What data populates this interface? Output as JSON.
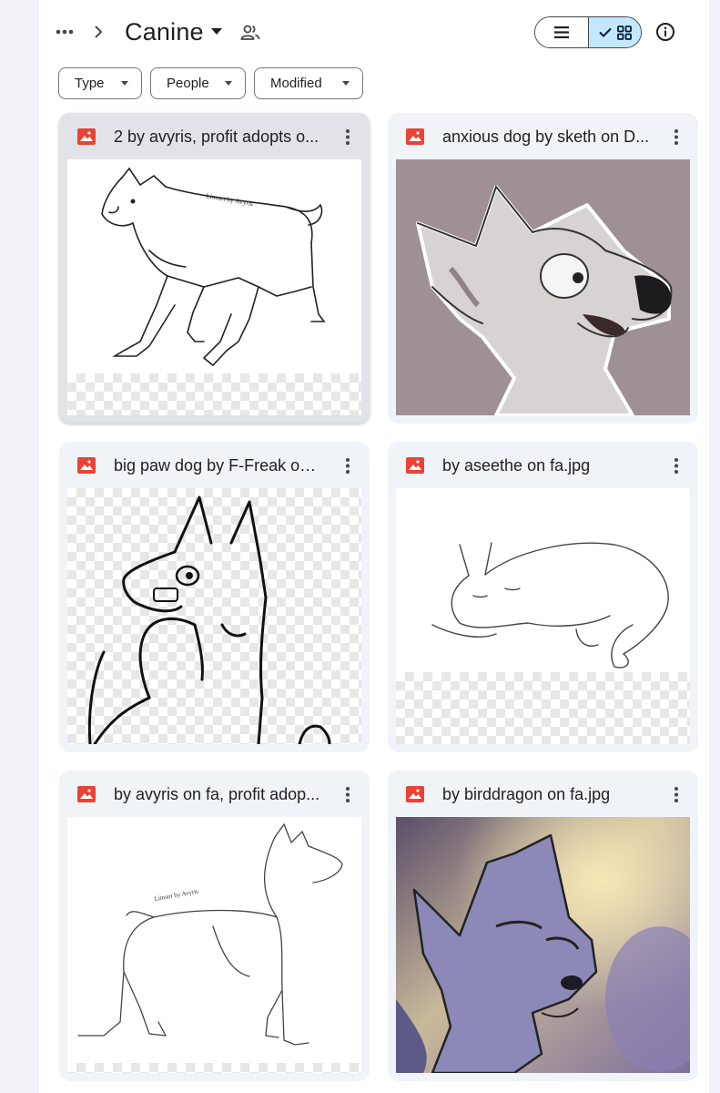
{
  "header": {
    "folder_title": "Canine",
    "view_toggle": {
      "list_icon": "list-icon",
      "grid_icon": "grid-icon",
      "selected": "grid"
    }
  },
  "filters": [
    {
      "label": "Type"
    },
    {
      "label": "People"
    },
    {
      "label": "Modified"
    }
  ],
  "files": [
    {
      "name": "2 by avyris, profit adopts on fa.png",
      "display": "2 by avyris, profit adopts o...",
      "icon": "image-file-icon",
      "selected": true
    },
    {
      "name": "anxious dog by sketh on DA.jpg",
      "display": "anxious dog by sketh on D...",
      "icon": "image-file-icon",
      "selected": false
    },
    {
      "name": "big paw dog by F-Freak on DA.png",
      "display": "big paw dog by F-Freak on ...",
      "icon": "image-file-icon",
      "selected": false
    },
    {
      "name": "by aseethe on fa.jpg",
      "display": "by aseethe on fa.jpg",
      "icon": "image-file-icon",
      "selected": false
    },
    {
      "name": "by avyris on fa, profit adopts.png",
      "display": "by avyris on fa, profit adop...",
      "icon": "image-file-icon",
      "selected": false
    },
    {
      "name": "by birddragon on fa.jpg",
      "display": "by birddragon on fa.jpg",
      "icon": "image-file-icon",
      "selected": false
    }
  ],
  "thumbnails": {
    "watermark_1": "Lineart by Avyris",
    "watermark_5": "Lineart by Avyris"
  },
  "colors": {
    "accent_selected": "#c2e7ff",
    "file_icon_red": "#ea4335",
    "card_bg": "#f0f4f9"
  }
}
